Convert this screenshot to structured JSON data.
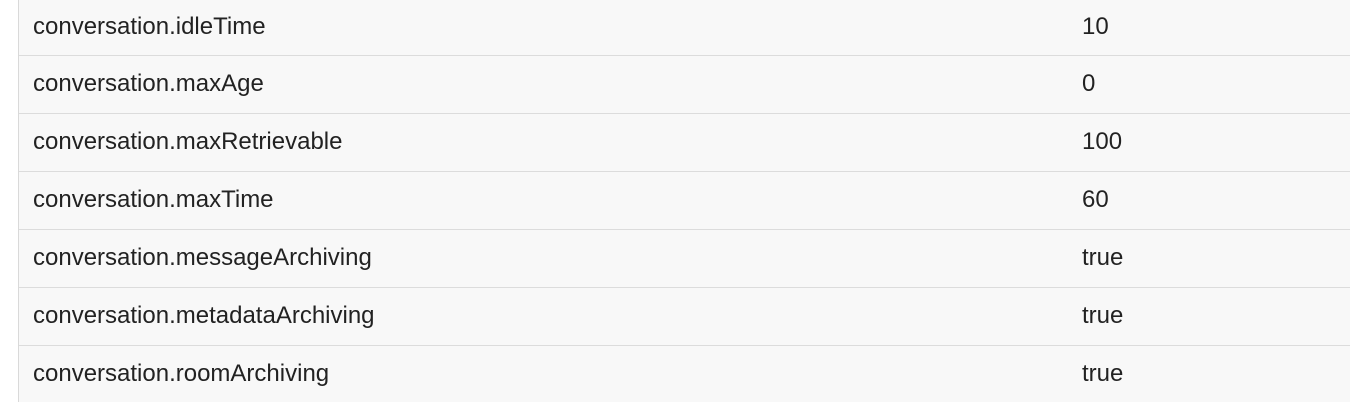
{
  "properties": [
    {
      "key": "conversation.idleTime",
      "value": "10"
    },
    {
      "key": "conversation.maxAge",
      "value": "0"
    },
    {
      "key": "conversation.maxRetrievable",
      "value": "100"
    },
    {
      "key": "conversation.maxTime",
      "value": "60"
    },
    {
      "key": "conversation.messageArchiving",
      "value": "true"
    },
    {
      "key": "conversation.metadataArchiving",
      "value": "true"
    },
    {
      "key": "conversation.roomArchiving",
      "value": "true"
    }
  ]
}
